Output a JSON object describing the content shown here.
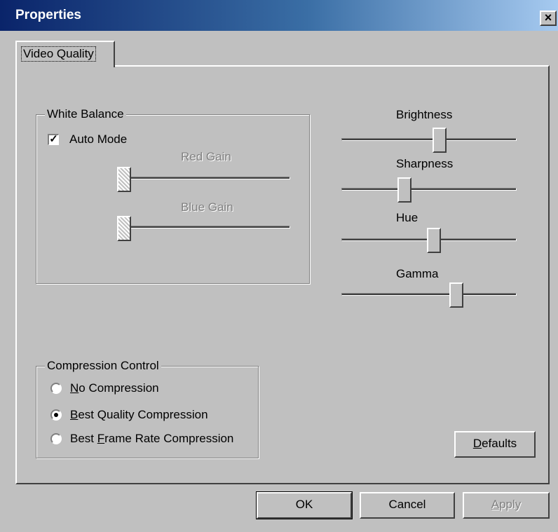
{
  "window": {
    "title": "Properties",
    "close_label": "×"
  },
  "tabs": [
    {
      "label": "Video Quality",
      "selected": true
    }
  ],
  "white_balance": {
    "legend": "White Balance",
    "auto_mode": {
      "label": "Auto Mode",
      "checked": true
    },
    "red_gain": {
      "label": "Red Gain",
      "value": 0,
      "enabled": false
    },
    "blue_gain": {
      "label": "Blue Gain",
      "value": 0,
      "enabled": false
    }
  },
  "sliders": [
    {
      "label": "Brightness",
      "value": 0.57
    },
    {
      "label": "Sharpness",
      "value": 0.37
    },
    {
      "label": "Hue",
      "value": 0.53
    },
    {
      "label": "Gamma",
      "value": 0.66
    }
  ],
  "compression": {
    "legend": "Compression Control",
    "options": [
      {
        "label_pre": "",
        "mnemonic": "N",
        "label_post": "o Compression",
        "selected": false
      },
      {
        "label_pre": "",
        "mnemonic": "B",
        "label_post": "est Quality Compression",
        "selected": true
      },
      {
        "label_pre": "Best ",
        "mnemonic": "F",
        "label_post": "rame Rate Compression",
        "selected": false
      }
    ]
  },
  "buttons": {
    "defaults": {
      "mnemonic": "D",
      "rest": "efaults"
    },
    "ok": "OK",
    "cancel": "Cancel",
    "apply": {
      "mnemonic": "A",
      "rest": "pply",
      "enabled": false
    }
  },
  "colors": {
    "face": "#c0c0c0",
    "title_start": "#0a246a",
    "title_end": "#a6caf0"
  }
}
